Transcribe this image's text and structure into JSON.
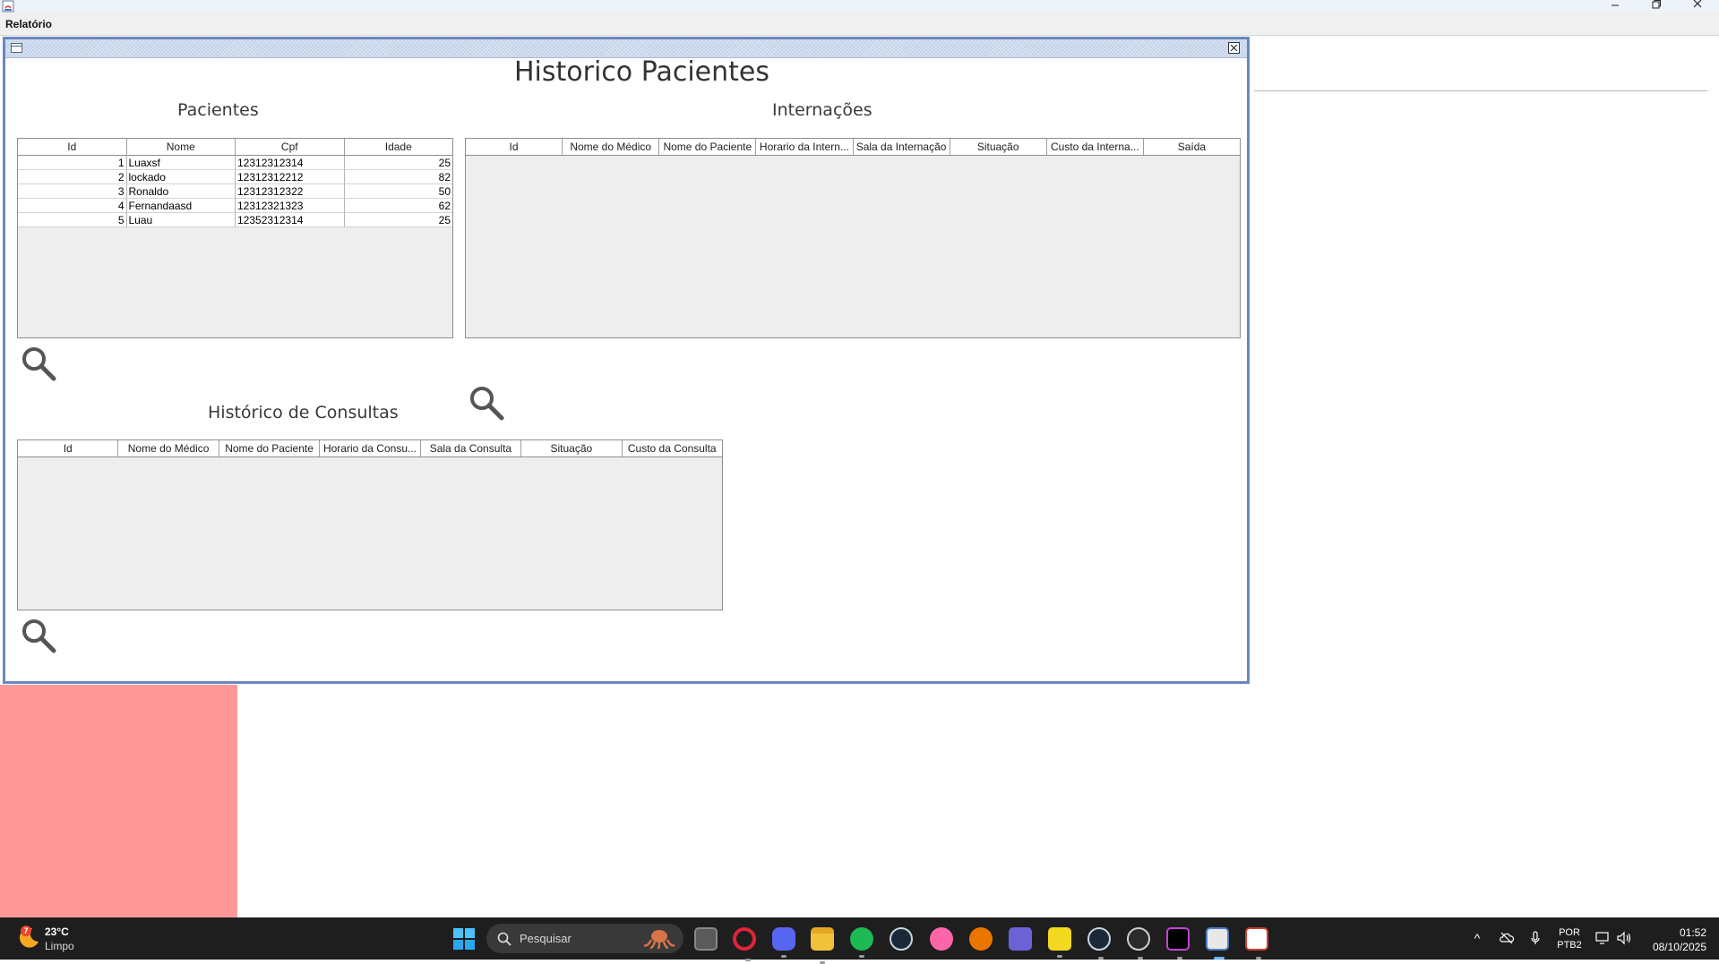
{
  "window": {
    "menu": [
      "Relatório"
    ]
  },
  "frame": {
    "title": "Historico Pacientes",
    "pacientes": {
      "title": "Pacientes",
      "columns": [
        "Id",
        "Nome",
        "Cpf",
        "Idade"
      ],
      "rows": [
        [
          "1",
          "Luaxsf",
          "12312312314",
          "25"
        ],
        [
          "2",
          "lockado",
          "12312312212",
          "82"
        ],
        [
          "3",
          "Ronaldo",
          "12312312322",
          "50"
        ],
        [
          "4",
          "Fernandaasd",
          "12312321323",
          "62"
        ],
        [
          "5",
          "Luau",
          "12352312314",
          "25"
        ]
      ]
    },
    "internacoes": {
      "title": "Internações",
      "columns": [
        "Id",
        "Nome do Médico",
        "Nome do Paciente",
        "Horario da Intern...",
        "Sala da Internação",
        "Situação",
        "Custo da Interna...",
        "Saída"
      ],
      "rows": []
    },
    "consultas": {
      "title": "Histórico de Consultas",
      "columns": [
        "Id",
        "Nome do Médico",
        "Nome do Paciente",
        "Horario da Consu...",
        "Sala da Consulta",
        "Situação",
        "Custo da Consulta"
      ],
      "rows": []
    }
  },
  "taskbar": {
    "weather": {
      "temp": "23°C",
      "condition": "Limpo",
      "badge": "7"
    },
    "search_placeholder": "Pesquisar",
    "apps": [
      "task-view",
      "opera",
      "discord",
      "file-explorer",
      "spotify",
      "steam",
      "osu",
      "blender",
      "notes",
      "todo",
      "steam-2",
      "obs",
      "intellij",
      "java",
      "java-2"
    ],
    "language": {
      "lang": "POR",
      "layout": "PTB2"
    },
    "clock": {
      "time": "01:52",
      "date": "08/10/2025"
    }
  },
  "colors": {
    "frame_border": "#6b87c1",
    "pink_block": "#ff9999",
    "taskbar": "#1f1e1e"
  }
}
